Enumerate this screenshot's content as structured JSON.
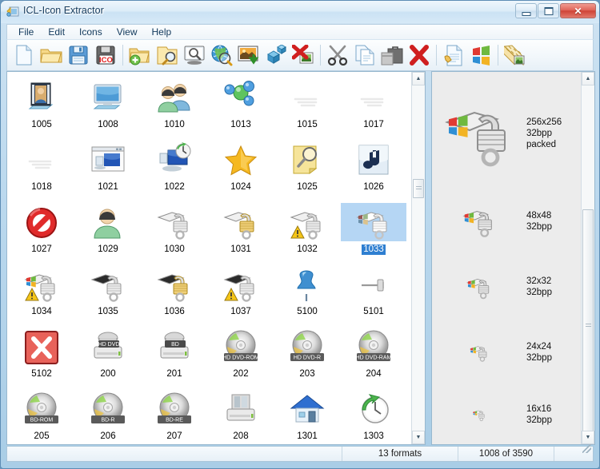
{
  "window": {
    "title": "ICL-Icon Extractor",
    "app_icon": "app-icon",
    "controls": {
      "minimize": "Minimize",
      "restore": "Restore",
      "close": "Close"
    }
  },
  "menu": {
    "items": [
      "File",
      "Edit",
      "Icons",
      "View",
      "Help"
    ]
  },
  "toolbar": {
    "buttons": [
      {
        "name": "new-icon-library",
        "icon": "new-document-icon"
      },
      {
        "name": "open-library",
        "icon": "open-folder-icon"
      },
      {
        "name": "save-library",
        "icon": "floppy-save-icon"
      },
      {
        "name": "save-as-ico",
        "icon": "floppy-ico-icon"
      },
      {
        "sep": true
      },
      {
        "name": "add-folder",
        "icon": "folder-add-icon"
      },
      {
        "name": "search-folder",
        "icon": "folder-search-icon"
      },
      {
        "name": "preview-monitor",
        "icon": "monitor-search-icon"
      },
      {
        "name": "search-web",
        "icon": "globe-search-icon"
      },
      {
        "name": "import-image",
        "icon": "import-image-icon"
      },
      {
        "name": "extract-objects",
        "icon": "blue-cubes-icon"
      },
      {
        "name": "delete-image",
        "icon": "delete-image-icon"
      },
      {
        "sep": true
      },
      {
        "name": "cut",
        "icon": "scissors-icon"
      },
      {
        "name": "copy",
        "icon": "copy-pages-icon"
      },
      {
        "name": "paste",
        "icon": "briefcase-icon"
      },
      {
        "name": "delete",
        "icon": "red-x-icon"
      },
      {
        "sep": true
      },
      {
        "name": "properties",
        "icon": "document-hand-icon"
      },
      {
        "name": "windows-icons",
        "icon": "windows-logo-icon"
      },
      {
        "sep": true
      },
      {
        "name": "resize-image",
        "icon": "ruler-image-icon"
      }
    ]
  },
  "icon_grid": {
    "columns": 6,
    "selected_id": "1033",
    "items": [
      {
        "id": "1005",
        "art": "film-strip"
      },
      {
        "id": "1008",
        "art": "monitor"
      },
      {
        "id": "1010",
        "art": "two-users"
      },
      {
        "id": "1013",
        "art": "molecule"
      },
      {
        "id": "1015",
        "art": "faint-lines"
      },
      {
        "id": "1017",
        "art": "faint-lines"
      },
      {
        "id": "1018",
        "art": "faint-lines"
      },
      {
        "id": "1021",
        "art": "window-monitor"
      },
      {
        "id": "1022",
        "art": "monitor-clock"
      },
      {
        "id": "1024",
        "art": "star"
      },
      {
        "id": "1025",
        "art": "magnifier-note"
      },
      {
        "id": "1026",
        "art": "music-note"
      },
      {
        "id": "1027",
        "art": "no-entry"
      },
      {
        "id": "1029",
        "art": "user"
      },
      {
        "id": "1030",
        "art": "lock-silver"
      },
      {
        "id": "1031",
        "art": "lock-gold"
      },
      {
        "id": "1032",
        "art": "lock-silver-warn"
      },
      {
        "id": "1033",
        "art": "lock-windows"
      },
      {
        "id": "1034",
        "art": "lock-windows-warn"
      },
      {
        "id": "1035",
        "art": "lock-silver-dark"
      },
      {
        "id": "1036",
        "art": "lock-gold-dark"
      },
      {
        "id": "1037",
        "art": "lock-silver-warn2"
      },
      {
        "id": "5100",
        "art": "pushpin-blue"
      },
      {
        "id": "5101",
        "art": "pushpin-grey"
      },
      {
        "id": "5102",
        "art": "red-x-box"
      },
      {
        "id": "200",
        "art": "drive-hddvd",
        "badge": "HD DVD"
      },
      {
        "id": "201",
        "art": "drive-bd",
        "badge": "BD"
      },
      {
        "id": "202",
        "art": "disc",
        "badge": "HD DVD-ROM"
      },
      {
        "id": "203",
        "art": "disc",
        "badge": "HD DVD-R"
      },
      {
        "id": "204",
        "art": "disc",
        "badge": "HD DVD-RAM"
      },
      {
        "id": "205",
        "art": "disc",
        "badge": "BD-ROM"
      },
      {
        "id": "206",
        "art": "disc",
        "badge": "BD-R"
      },
      {
        "id": "207",
        "art": "disc",
        "badge": "BD-RE"
      },
      {
        "id": "208",
        "art": "drive-plain"
      },
      {
        "id": "1301",
        "art": "house"
      },
      {
        "id": "1303",
        "art": "clock-back"
      }
    ]
  },
  "format_panel": {
    "formats": [
      {
        "size": "256x256",
        "depth": "32bpp",
        "note": "packed",
        "art": "lock-windows-big"
      },
      {
        "size": "48x48",
        "depth": "32bpp",
        "note": "",
        "art": "lock-windows-48"
      },
      {
        "size": "32x32",
        "depth": "32bpp",
        "note": "",
        "art": "lock-windows-32"
      },
      {
        "size": "24x24",
        "depth": "32bpp",
        "note": "",
        "art": "lock-windows-24"
      },
      {
        "size": "16x16",
        "depth": "32bpp",
        "note": "",
        "art": "lock-windows-16"
      }
    ]
  },
  "statusbar": {
    "panel0": "",
    "formats_count": "13 formats",
    "position": "1008 of 3590"
  },
  "colors": {
    "selection_blue": "#2f7fd1",
    "title_text": "#12395c",
    "window_frame": "#5c8cb4",
    "pane_border": "#98b8cf"
  }
}
